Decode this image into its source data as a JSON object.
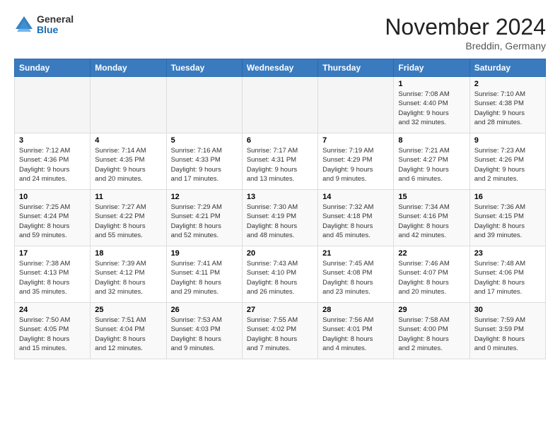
{
  "header": {
    "logo_general": "General",
    "logo_blue": "Blue",
    "title": "November 2024",
    "location": "Breddin, Germany"
  },
  "weekdays": [
    "Sunday",
    "Monday",
    "Tuesday",
    "Wednesday",
    "Thursday",
    "Friday",
    "Saturday"
  ],
  "weeks": [
    [
      {
        "day": "",
        "info": ""
      },
      {
        "day": "",
        "info": ""
      },
      {
        "day": "",
        "info": ""
      },
      {
        "day": "",
        "info": ""
      },
      {
        "day": "",
        "info": ""
      },
      {
        "day": "1",
        "info": "Sunrise: 7:08 AM\nSunset: 4:40 PM\nDaylight: 9 hours\nand 32 minutes."
      },
      {
        "day": "2",
        "info": "Sunrise: 7:10 AM\nSunset: 4:38 PM\nDaylight: 9 hours\nand 28 minutes."
      }
    ],
    [
      {
        "day": "3",
        "info": "Sunrise: 7:12 AM\nSunset: 4:36 PM\nDaylight: 9 hours\nand 24 minutes."
      },
      {
        "day": "4",
        "info": "Sunrise: 7:14 AM\nSunset: 4:35 PM\nDaylight: 9 hours\nand 20 minutes."
      },
      {
        "day": "5",
        "info": "Sunrise: 7:16 AM\nSunset: 4:33 PM\nDaylight: 9 hours\nand 17 minutes."
      },
      {
        "day": "6",
        "info": "Sunrise: 7:17 AM\nSunset: 4:31 PM\nDaylight: 9 hours\nand 13 minutes."
      },
      {
        "day": "7",
        "info": "Sunrise: 7:19 AM\nSunset: 4:29 PM\nDaylight: 9 hours\nand 9 minutes."
      },
      {
        "day": "8",
        "info": "Sunrise: 7:21 AM\nSunset: 4:27 PM\nDaylight: 9 hours\nand 6 minutes."
      },
      {
        "day": "9",
        "info": "Sunrise: 7:23 AM\nSunset: 4:26 PM\nDaylight: 9 hours\nand 2 minutes."
      }
    ],
    [
      {
        "day": "10",
        "info": "Sunrise: 7:25 AM\nSunset: 4:24 PM\nDaylight: 8 hours\nand 59 minutes."
      },
      {
        "day": "11",
        "info": "Sunrise: 7:27 AM\nSunset: 4:22 PM\nDaylight: 8 hours\nand 55 minutes."
      },
      {
        "day": "12",
        "info": "Sunrise: 7:29 AM\nSunset: 4:21 PM\nDaylight: 8 hours\nand 52 minutes."
      },
      {
        "day": "13",
        "info": "Sunrise: 7:30 AM\nSunset: 4:19 PM\nDaylight: 8 hours\nand 48 minutes."
      },
      {
        "day": "14",
        "info": "Sunrise: 7:32 AM\nSunset: 4:18 PM\nDaylight: 8 hours\nand 45 minutes."
      },
      {
        "day": "15",
        "info": "Sunrise: 7:34 AM\nSunset: 4:16 PM\nDaylight: 8 hours\nand 42 minutes."
      },
      {
        "day": "16",
        "info": "Sunrise: 7:36 AM\nSunset: 4:15 PM\nDaylight: 8 hours\nand 39 minutes."
      }
    ],
    [
      {
        "day": "17",
        "info": "Sunrise: 7:38 AM\nSunset: 4:13 PM\nDaylight: 8 hours\nand 35 minutes."
      },
      {
        "day": "18",
        "info": "Sunrise: 7:39 AM\nSunset: 4:12 PM\nDaylight: 8 hours\nand 32 minutes."
      },
      {
        "day": "19",
        "info": "Sunrise: 7:41 AM\nSunset: 4:11 PM\nDaylight: 8 hours\nand 29 minutes."
      },
      {
        "day": "20",
        "info": "Sunrise: 7:43 AM\nSunset: 4:10 PM\nDaylight: 8 hours\nand 26 minutes."
      },
      {
        "day": "21",
        "info": "Sunrise: 7:45 AM\nSunset: 4:08 PM\nDaylight: 8 hours\nand 23 minutes."
      },
      {
        "day": "22",
        "info": "Sunrise: 7:46 AM\nSunset: 4:07 PM\nDaylight: 8 hours\nand 20 minutes."
      },
      {
        "day": "23",
        "info": "Sunrise: 7:48 AM\nSunset: 4:06 PM\nDaylight: 8 hours\nand 17 minutes."
      }
    ],
    [
      {
        "day": "24",
        "info": "Sunrise: 7:50 AM\nSunset: 4:05 PM\nDaylight: 8 hours\nand 15 minutes."
      },
      {
        "day": "25",
        "info": "Sunrise: 7:51 AM\nSunset: 4:04 PM\nDaylight: 8 hours\nand 12 minutes."
      },
      {
        "day": "26",
        "info": "Sunrise: 7:53 AM\nSunset: 4:03 PM\nDaylight: 8 hours\nand 9 minutes."
      },
      {
        "day": "27",
        "info": "Sunrise: 7:55 AM\nSunset: 4:02 PM\nDaylight: 8 hours\nand 7 minutes."
      },
      {
        "day": "28",
        "info": "Sunrise: 7:56 AM\nSunset: 4:01 PM\nDaylight: 8 hours\nand 4 minutes."
      },
      {
        "day": "29",
        "info": "Sunrise: 7:58 AM\nSunset: 4:00 PM\nDaylight: 8 hours\nand 2 minutes."
      },
      {
        "day": "30",
        "info": "Sunrise: 7:59 AM\nSunset: 3:59 PM\nDaylight: 8 hours\nand 0 minutes."
      }
    ]
  ]
}
